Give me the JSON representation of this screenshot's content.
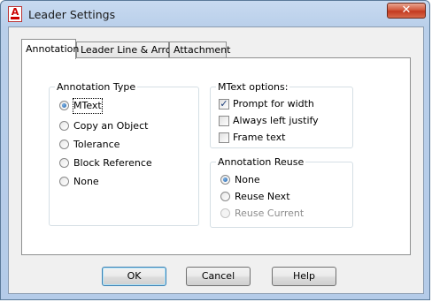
{
  "window": {
    "title": "Leader Settings",
    "close_glyph": "✕",
    "icon_letter": "A"
  },
  "tabs": [
    {
      "label": "Annotation",
      "active": true
    },
    {
      "label": "Leader Line & Arrow",
      "active": false
    },
    {
      "label": "Attachment",
      "active": false
    }
  ],
  "annotation_type": {
    "legend": "Annotation Type",
    "options": [
      {
        "label": "MText",
        "checked": true
      },
      {
        "label": "Copy an Object",
        "checked": false
      },
      {
        "label": "Tolerance",
        "checked": false
      },
      {
        "label": "Block Reference",
        "checked": false
      },
      {
        "label": "None",
        "checked": false
      }
    ]
  },
  "mtext_options": {
    "legend": "MText options:",
    "options": [
      {
        "label": "Prompt for width",
        "checked": true
      },
      {
        "label": "Always left justify",
        "checked": false
      },
      {
        "label": "Frame text",
        "checked": false
      }
    ]
  },
  "annotation_reuse": {
    "legend": "Annotation Reuse",
    "options": [
      {
        "label": "None",
        "checked": true,
        "enabled": true
      },
      {
        "label": "Reuse Next",
        "checked": false,
        "enabled": true
      },
      {
        "label": "Reuse Current",
        "checked": false,
        "enabled": false
      }
    ]
  },
  "buttons": {
    "ok": "OK",
    "cancel": "Cancel",
    "help": "Help"
  },
  "icons": {
    "checkmark": "✓"
  }
}
